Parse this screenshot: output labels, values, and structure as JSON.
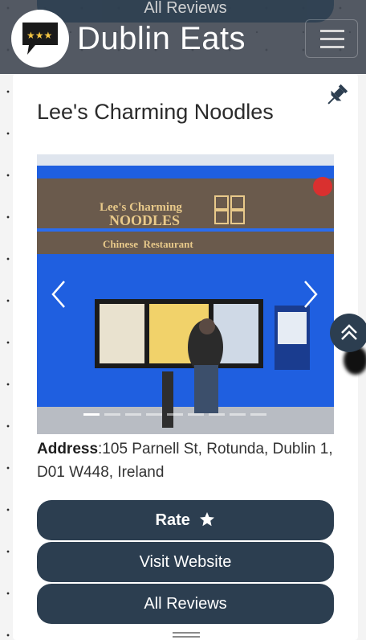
{
  "navbar": {
    "brand": "Dublin Eats",
    "background": "#444b56",
    "overlay_pill_label": "All Reviews"
  },
  "restaurant": {
    "name": "Lee's Charming Noodles",
    "address_label": "Address",
    "address_value": ":105 Parnell St, Rotunda, Dublin 1, D01 W448, Ireland"
  },
  "carousel": {
    "sign_line1": "Lee's Charming",
    "sign_line2": "NOODLES",
    "sign_line3": "Chinese  Restaurant",
    "prev_icon": "chevron-left-icon",
    "next_icon": "chevron-right-icon",
    "slide_count": 9,
    "active_slide": 1
  },
  "buttons": {
    "rate": "Rate",
    "visit": "Visit Website",
    "reviews": "All Reviews"
  },
  "colors": {
    "button": "#2c3e50",
    "storefront_blue": "#1f5fe0"
  }
}
